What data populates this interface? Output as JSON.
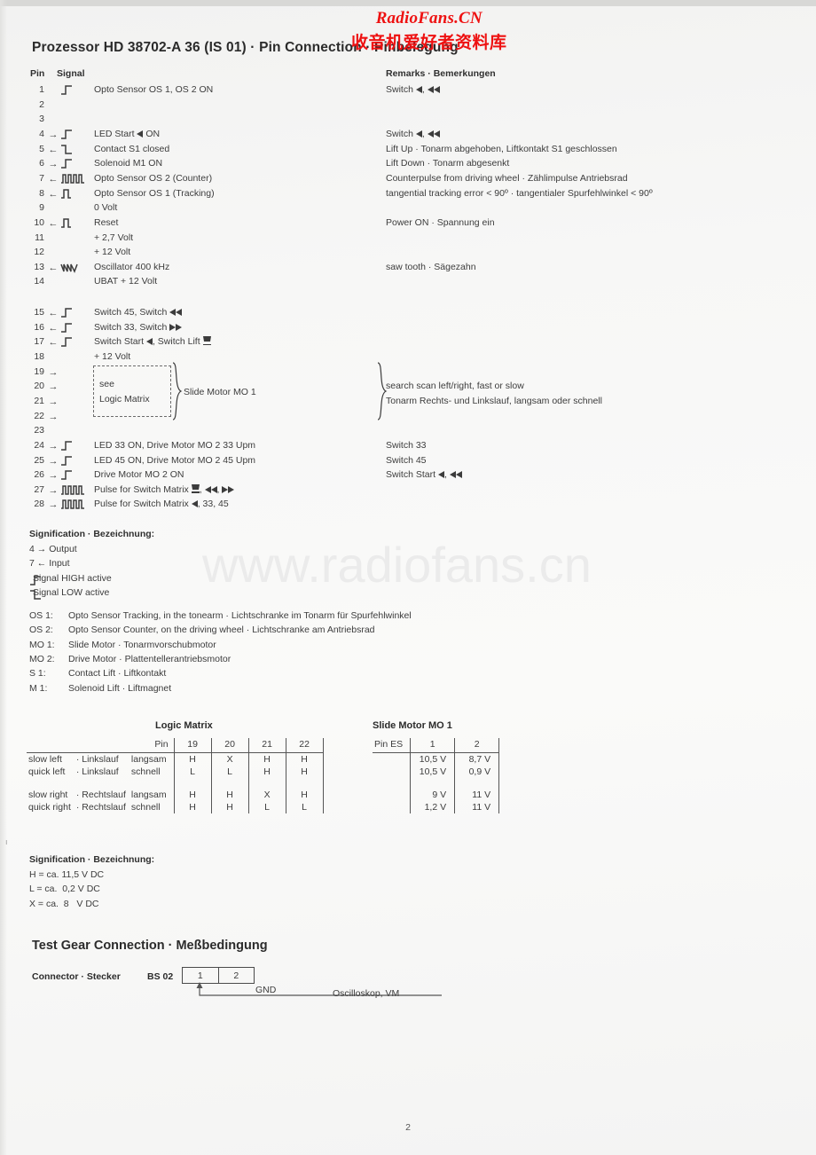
{
  "watermark": {
    "top_en": "RadioFans.CN",
    "top_cn": "收音机爱好者资料库",
    "mid": "www.radiofans.cn",
    "color": "#ee1111"
  },
  "title": "Prozessor HD 38702-A 36 (IS 01) · Pin Connection · Pinbelegung",
  "columns": {
    "pin": "Pin",
    "signal": "Signal",
    "remarks": "Remarks · Bemerkungen"
  },
  "pins": [
    {
      "num": "1",
      "dir": "",
      "wave": "rising",
      "signal": "Opto Sensor OS 1, OS 2 ON",
      "remark": "Switch ◀, ◀◀"
    },
    {
      "num": "2",
      "dir": "",
      "wave": "",
      "signal": "",
      "remark": ""
    },
    {
      "num": "3",
      "dir": "",
      "wave": "",
      "signal": "",
      "remark": ""
    },
    {
      "num": "4",
      "dir": "→",
      "wave": "rising",
      "signal": "LED Start ◀ ON",
      "remark": "Switch ◀, ◀◀"
    },
    {
      "num": "5",
      "dir": "←",
      "wave": "falling",
      "signal": "Contact S1 closed",
      "remark": "Lift Up · Tonarm abgehoben, Liftkontakt S1 geschlossen"
    },
    {
      "num": "6",
      "dir": "→",
      "wave": "rising",
      "signal": "Solenoid M1 ON",
      "remark": "Lift Down · Tonarm abgesenkt"
    },
    {
      "num": "7",
      "dir": "←",
      "wave": "pulses",
      "signal": "Opto Sensor OS 2 (Counter)",
      "remark": "Counterpulse from driving wheel · Zählimpulse Antriebsrad"
    },
    {
      "num": "8",
      "dir": "←",
      "wave": "onepulse",
      "signal": "Opto Sensor OS 1 (Tracking)",
      "remark": "tangential tracking error < 90º · tangentialer Spurfehlwinkel < 90º"
    },
    {
      "num": "9",
      "dir": "",
      "wave": "",
      "signal": "0 Volt",
      "remark": ""
    },
    {
      "num": "10",
      "dir": "←",
      "wave": "onepulse",
      "signal": "Reset",
      "remark": "Power ON · Spannung ein"
    },
    {
      "num": "11",
      "dir": "",
      "wave": "",
      "signal": "+ 2,7 Volt",
      "remark": ""
    },
    {
      "num": "12",
      "dir": "",
      "wave": "",
      "signal": "+ 12 Volt",
      "remark": ""
    },
    {
      "num": "13",
      "dir": "←",
      "wave": "sawtooth",
      "signal": "Oscillator 400 kHz",
      "remark": "saw tooth · Sägezahn"
    },
    {
      "num": "14",
      "dir": "",
      "wave": "",
      "signal": "UBAT + 12 Volt",
      "remark": ""
    }
  ],
  "pins2": [
    {
      "num": "15",
      "dir": "←",
      "wave": "rising",
      "signal": "Switch 45, Switch ◀◀",
      "remark": ""
    },
    {
      "num": "16",
      "dir": "←",
      "wave": "rising",
      "signal": "Switch 33, Switch ▶▶",
      "remark": ""
    },
    {
      "num": "17",
      "dir": "←",
      "wave": "rising",
      "signal": "Switch Start ◀, Switch Lift ⧗",
      "remark": ""
    },
    {
      "num": "18",
      "dir": "",
      "wave": "",
      "signal": "+ 12 Volt",
      "remark": ""
    },
    {
      "num": "19",
      "dir": "→",
      "wave": "",
      "signal": "",
      "remark": ""
    },
    {
      "num": "20",
      "dir": "→",
      "wave": "",
      "signal": "",
      "remark": "search scan left/right, fast or slow"
    },
    {
      "num": "21",
      "dir": "→",
      "wave": "",
      "signal": "",
      "remark": "Tonarm Rechts- und Linkslauf, langsam oder schnell"
    },
    {
      "num": "22",
      "dir": "→",
      "wave": "",
      "signal": "",
      "remark": ""
    },
    {
      "num": "23",
      "dir": "",
      "wave": "",
      "signal": "",
      "remark": ""
    },
    {
      "num": "24",
      "dir": "→",
      "wave": "rising",
      "signal": "LED 33 ON, Drive Motor MO 2 33 Upm",
      "remark": "Switch 33"
    },
    {
      "num": "25",
      "dir": "→",
      "wave": "rising",
      "signal": "LED 45 ON, Drive Motor MO 2 45 Upm",
      "remark": "Switch 45"
    },
    {
      "num": "26",
      "dir": "→",
      "wave": "rising",
      "signal": "Drive Motor MO 2 ON",
      "remark": "Switch Start ◀, ◀◀"
    },
    {
      "num": "27",
      "dir": "→",
      "wave": "pulses",
      "signal": "Pulse for Switch Matrix ⧗, ◀◀, ▶▶",
      "remark": ""
    },
    {
      "num": "28",
      "dir": "→",
      "wave": "pulses",
      "signal": "Pulse for Switch Matrix ◀, 33, 45",
      "remark": ""
    }
  ],
  "logic_box": {
    "line1": "see",
    "line2": "Logic Matrix",
    "slide_motor_label": "Slide Motor MO 1"
  },
  "signification1": {
    "title": "Signification · Bezeichnung:",
    "lines": [
      {
        "key": "4 →",
        "text": "Output",
        "glyph": ""
      },
      {
        "key": "7 ←",
        "text": "Input",
        "glyph": ""
      },
      {
        "key": "",
        "text": "Signal HIGH active",
        "glyph": "rising"
      },
      {
        "key": "",
        "text": "Signal LOW active",
        "glyph": "falling"
      }
    ]
  },
  "abbreviations": [
    {
      "key": "OS 1:",
      "text": "Opto Sensor Tracking, in the tonearm · Lichtschranke im Tonarm für Spurfehlwinkel"
    },
    {
      "key": "OS 2:",
      "text": "Opto Sensor Counter, on the driving wheel · Lichtschranke am Antriebsrad"
    },
    {
      "key": "MO 1:",
      "text": "Slide Motor · Tonarmvorschubmotor"
    },
    {
      "key": "MO 2:",
      "text": "Drive Motor · Plattentellerantriebsmotor"
    },
    {
      "key": "S 1:",
      "text": "Contact Lift · Liftkontakt"
    },
    {
      "key": "M 1:",
      "text": "Solenoid Lift · Liftmagnet"
    }
  ],
  "logic_matrix": {
    "title": "Logic Matrix",
    "pin_header": "Pin",
    "columns": [
      "19",
      "20",
      "21",
      "22"
    ],
    "rows": [
      {
        "en": "slow left",
        "sep": "·",
        "de": "Linkslauf",
        "speed": "langsam",
        "values": [
          "H",
          "X",
          "H",
          "H"
        ]
      },
      {
        "en": "quick left",
        "sep": "·",
        "de": "Linkslauf",
        "speed": "schnell",
        "values": [
          "L",
          "L",
          "H",
          "H"
        ]
      },
      {
        "en": "slow right",
        "sep": "·",
        "de": "Rechtslauf",
        "speed": "langsam",
        "values": [
          "H",
          "H",
          "X",
          "H"
        ]
      },
      {
        "en": "quick right",
        "sep": "·",
        "de": "Rechtslauf",
        "speed": "schnell",
        "values": [
          "H",
          "H",
          "L",
          "L"
        ]
      }
    ]
  },
  "slide_motor": {
    "title": "Slide Motor MO 1",
    "pin_header": "Pin ES",
    "columns": [
      "1",
      "2"
    ],
    "rows": [
      {
        "values": [
          "10,5 V",
          "8,7 V"
        ]
      },
      {
        "values": [
          "10,5 V",
          "0,9 V"
        ]
      },
      {
        "values": [
          "9 V",
          "11 V"
        ]
      },
      {
        "values": [
          "1,2 V",
          "11 V"
        ]
      }
    ]
  },
  "signification2": {
    "title": "Signification · Bezeichnung:",
    "lines": [
      "H = ca. 11,5 V DC",
      "L = ca.  0,2 V DC",
      "X = ca.  8   V DC"
    ]
  },
  "test_gear": {
    "title": "Test Gear Connection · Meßbedingung",
    "connector_label": "Connector · Stecker",
    "connector_name": "BS 02",
    "pins": [
      "1",
      "2"
    ],
    "gnd": "GND",
    "instrument": "Oscilloskop, VM"
  },
  "page_number": "2"
}
